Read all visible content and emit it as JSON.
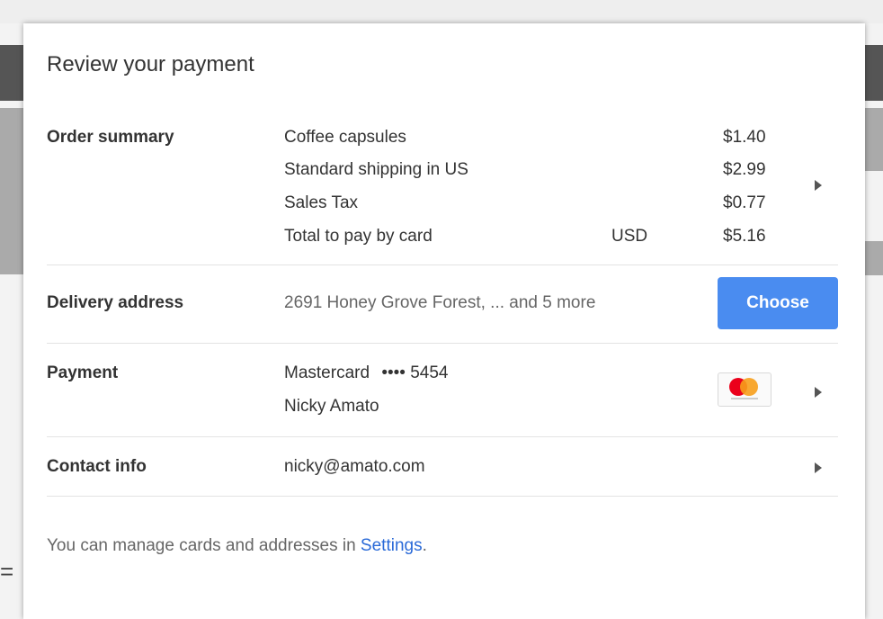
{
  "dialog": {
    "title": "Review your payment"
  },
  "order_summary": {
    "label": "Order summary",
    "items": [
      {
        "name": "Coffee capsules",
        "price": "$1.40"
      },
      {
        "name": "Standard shipping in US",
        "price": "$2.99"
      },
      {
        "name": "Sales Tax",
        "price": "$0.77"
      }
    ],
    "total": {
      "name": "Total to pay by card",
      "currency": "USD",
      "price": "$5.16"
    }
  },
  "delivery": {
    "label": "Delivery address",
    "value": "2691 Honey Grove Forest, ... and 5 more",
    "button_label": "Choose"
  },
  "payment": {
    "label": "Payment",
    "card": "Mastercard",
    "masked": "•••• 5454",
    "holder": "Nicky Amato",
    "logo_icon": "mastercard-icon"
  },
  "contact": {
    "label": "Contact info",
    "email": "nicky@amato.com"
  },
  "footer": {
    "text": "You can manage cards and addresses in ",
    "link": "Settings",
    "suffix": "."
  },
  "colors": {
    "accent": "#4a8cf0",
    "link": "#2a6ad8"
  }
}
